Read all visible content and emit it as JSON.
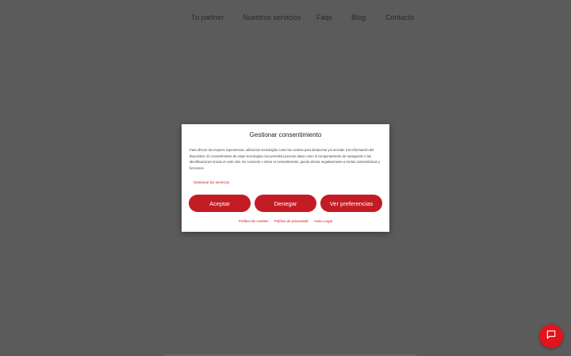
{
  "nav": {
    "items": [
      "Tu partner",
      "Nuestros servicios",
      "Faqs",
      "Blog",
      "Contacto"
    ]
  },
  "modal": {
    "title": "Gestionar consentimiento",
    "body": "Para ofrecer las mejores experiencias, utilizamos tecnologías como las cookies para almacenar y/o acceder a la información del dispositivo. El consentimiento de estas tecnologías nos permitirá procesar datos como el comportamiento de navegación o las identificaciones únicas en este sitio. No consentir o retirar el consentimiento, puede afectar negativamente a ciertas características y funciones.",
    "manage_link": "Gestionar los servicios",
    "buttons": {
      "accept": "Aceptar",
      "deny": "Denegar",
      "preferences": "Ver preferencias"
    },
    "footer_links": [
      "Política de cookies",
      "Política de privacidad",
      "Aviso Legal"
    ]
  },
  "chat": {
    "icon": "chat-bubble-icon"
  },
  "colors": {
    "accent": "#c41c24",
    "overlay": "#5b5b5b",
    "chat": "#e3131b"
  }
}
